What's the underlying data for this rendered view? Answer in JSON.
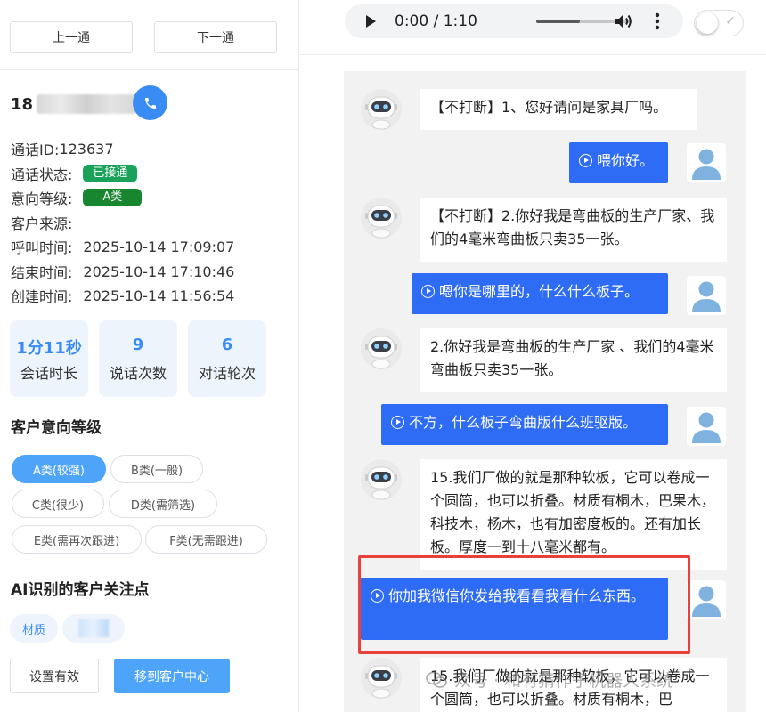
{
  "nav": {
    "prev_label": "上一通",
    "next_label": "下一通"
  },
  "phone": {
    "prefix": "18"
  },
  "info": {
    "call_id_label": "通话ID:",
    "call_id": "123637",
    "status_label": "通话状态:",
    "status": "已接通",
    "intent_label": "意向等级:",
    "intent": "A类",
    "source_label": "客户来源:",
    "source": "",
    "call_time_label": "呼叫时间:",
    "call_time": "2025-10-14 17:09:07",
    "end_time_label": "结束时间:",
    "end_time": "2025-10-14 17:10:46",
    "create_time_label": "创建时间:",
    "create_time": "2025-10-14 11:56:54"
  },
  "stats": [
    {
      "value": "1分11秒",
      "label": "会话时长"
    },
    {
      "value": "9",
      "label": "说话次数"
    },
    {
      "value": "6",
      "label": "对话轮次"
    }
  ],
  "intent_section": {
    "title": "客户意向等级",
    "options": [
      "A类(较强)",
      "B类(一般)",
      "C类(很少)",
      "D类(需筛选)",
      "E类(需再次跟进)",
      "F类(无需跟进)"
    ],
    "selected": "A类(较强)"
  },
  "focus_section": {
    "title": "AI识别的客户关注点",
    "tags": [
      "材质"
    ]
  },
  "actions": {
    "valid_label": "设置有效",
    "move_label": "移到客户中心"
  },
  "audio": {
    "time": "0:00 / 1:10",
    "progress": 0.45
  },
  "messages": [
    {
      "role": "bot",
      "text": "【不打断】1、您好请问是家具厂吗。"
    },
    {
      "role": "user",
      "text": "喂你好。"
    },
    {
      "role": "bot",
      "text": "【不打断】2.你好我是弯曲板的生产厂家、我们的4毫米弯曲板只卖35一张。"
    },
    {
      "role": "user",
      "text": "嗯你是哪里的，什么什么板子。"
    },
    {
      "role": "bot",
      "text": "2.你好我是弯曲板的生产厂家 、我们的4毫米弯曲板只卖35一张。"
    },
    {
      "role": "user",
      "text": "不方，什么板子弯曲版什么班驱版。"
    },
    {
      "role": "bot",
      "text": "15.我们厂做的就是那种软板，它可以卷成一个圆筒，也可以折叠。材质有桐木，巴果木，科技木，杨木，也有加密度板的。还有加长板。厚度一到十八毫米都有。"
    },
    {
      "role": "user",
      "text": "你加我微信你发给我看看我看什么东西。"
    },
    {
      "role": "bot",
      "text": "15.我们厂做的就是那种软板，它可以卷成一个圆筒，也可以折叠。材质有桐木，巴"
    }
  ],
  "watermark": "众号 · 和有猜作子机器人系统",
  "colors": {
    "accent": "#3a8cf5",
    "user_bubble": "#2f6cf5",
    "status_green": "#1aa25a",
    "highlight": "#e8413b"
  }
}
